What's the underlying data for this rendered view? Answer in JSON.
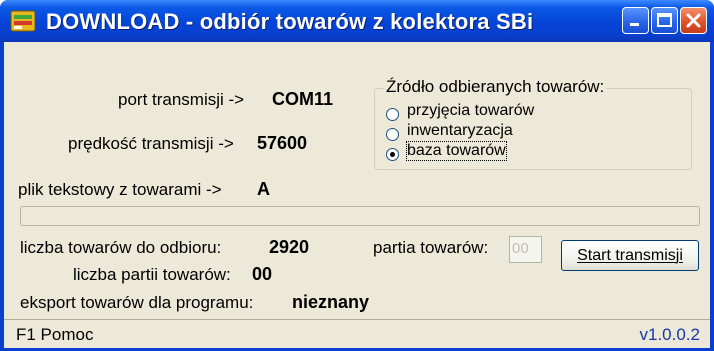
{
  "window": {
    "title": "DOWNLOAD - odbiór towarów z kolektora SBi"
  },
  "port": {
    "label": "port transmisji ->",
    "value": "COM11"
  },
  "speed": {
    "label": "prędkość transmisji ->",
    "value": "57600"
  },
  "file": {
    "label": "plik tekstowy z towarami ->",
    "value": "A"
  },
  "source": {
    "title": "Źródło odbieranych towarów:",
    "options": [
      {
        "label": "przyjęcia towarów",
        "checked": false
      },
      {
        "label": "inwentaryzacja",
        "checked": false
      },
      {
        "label": "baza towarów",
        "checked": true
      }
    ]
  },
  "count": {
    "label": "liczba towarów do odbioru:",
    "value": "2920"
  },
  "parts": {
    "label": "liczba partii towarów:",
    "value": "00"
  },
  "batch": {
    "label": "partia towarów:",
    "value": "00"
  },
  "export": {
    "label": "eksport towarów dla programu:",
    "value": "nieznany"
  },
  "buttons": {
    "start": "Start transmisji"
  },
  "status": {
    "help": "F1 Pomoc",
    "version": "v1.0.0.2"
  },
  "progress": {
    "fraction": 0
  }
}
